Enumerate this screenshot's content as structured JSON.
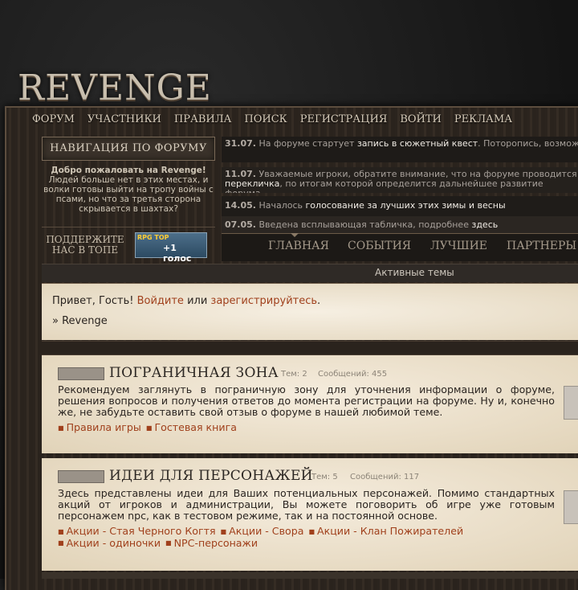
{
  "logo": "REVENGE",
  "topnav": [
    "ФОРУМ",
    "УЧАСТНИКИ",
    "ПРАВИЛА",
    "ПОИСК",
    "РЕГИСТРАЦИЯ",
    "ВОЙТИ",
    "РЕКЛАМА"
  ],
  "sidebar": {
    "nav_button": "НАВИГАЦИЯ ПО ФОРУМУ",
    "welcome_title": "Добро пожаловать на Revenge!",
    "welcome_text": "Людей больше нет в этих местах, и волки готовы выйти на тропу войны с псами, но что за третья сторона скрывается в шахтах?",
    "support_text": "ПОДДЕРЖИТЕ НАС В ТОПЕ",
    "rpg_top_label": "RPG TOP",
    "rpg_vote_label": "+1 голос"
  },
  "news": [
    {
      "date": "31.07.",
      "pre": "На форуме стартует ",
      "link": "запись в сюжетный квест",
      "post": ". Поторопись, возможно именно твой персонаж сыграет важную роль в противостоянии фракций!"
    },
    {
      "date": "11.07.",
      "pre": "Уважаемые игроки, обратите внимание, что на форуме проводится ",
      "link": "перекличка",
      "post": ", по итогам которой определится дальнейшее развитие форума."
    },
    {
      "date": "14.05.",
      "pre": "Началось ",
      "link": "голосование за лучших этих зимы и весны",
      "post": ""
    },
    {
      "date": "07.05.",
      "pre": "Введена всплывающая табличка, подробнее ",
      "link": "здесь",
      "post": ""
    }
  ],
  "mainnav": [
    "ГЛАВНАЯ",
    "СОБЫТИЯ",
    "ЛУЧШИЕ",
    "ПАРТНЕРЫ"
  ],
  "active_topics": "Активные темы",
  "greeting": {
    "hello": "Привет, Гость! ",
    "login": "Войдите",
    "or": " или ",
    "register": "зарегистрируйтесь",
    "dot": ".",
    "crumb": "» Revenge"
  },
  "forums": [
    {
      "title": "ПОГРАНИЧНАЯ ЗОНА",
      "topics": "Тем: 2",
      "posts": "Сообщений: 455",
      "desc": "Рекомендуем заглянуть в пограничную зону для уточнения информации о форуме, решения вопросов и получения ответов до момента регистрации на форуме. Ну и, конечно же, не забудьте оставить свой отзыв о форуме в нашей любимой теме.",
      "subforums": [
        "Правила игры",
        "Гостевая книга"
      ]
    },
    {
      "title": "ИДЕИ ДЛЯ ПЕРСОНАЖЕЙ",
      "topics": "Тем: 5",
      "posts": "Сообщений: 117",
      "desc": "Здесь представлены идеи для Ваших потенциальных персонажей. Помимо стандартных акций от игроков и администрации, Вы можете поговорить об игре уже готовым персонажем npc, как в тестовом режиме, так и на постоянной основе.",
      "subforums": [
        "Акции - Стая Черного Когтя",
        "Акции - Свора",
        "Акции - Клан Пожирателей",
        "Акции - одиночки",
        "NPC-персонажи"
      ]
    }
  ]
}
